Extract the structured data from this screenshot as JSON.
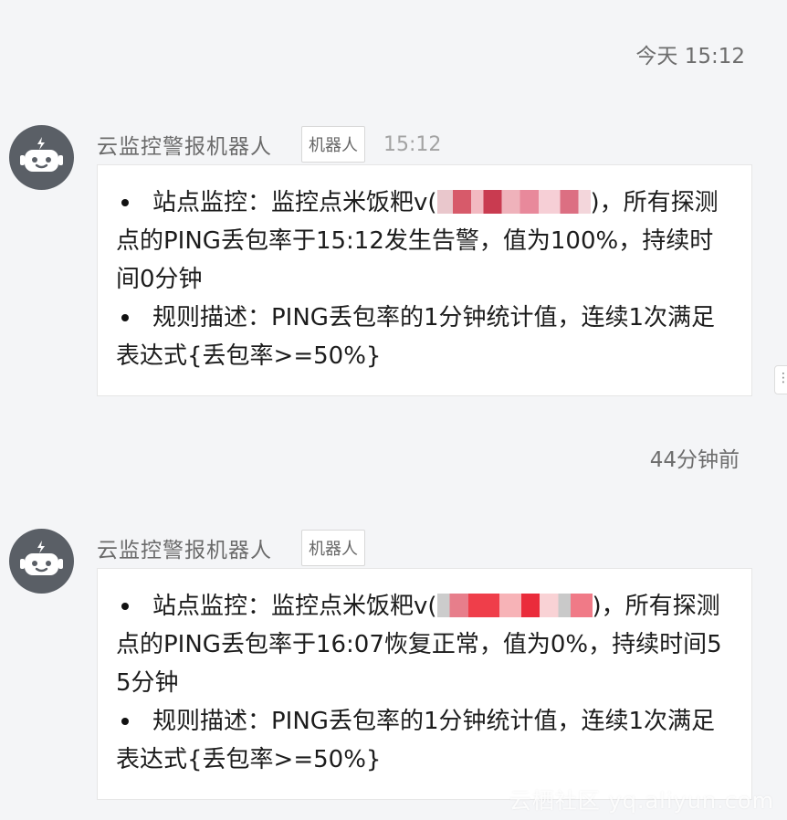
{
  "timestamps": [
    "今天 15:12",
    "44分钟前"
  ],
  "messages": [
    {
      "sender": "云监控警报机器人",
      "badge": "机器人",
      "time": "15:12",
      "items": [
        {
          "prefix": "站点监控：监控点米饭粑v(",
          "suffix": ")，所有探测点的PING丢包率于15:12发生告警，值为100%，持续时间0分钟"
        },
        {
          "text": "规则描述：PING丢包率的1分钟统计值，连续1次满足表达式{丢包率>=50%}"
        }
      ]
    },
    {
      "sender": "云监控警报机器人",
      "badge": "机器人",
      "time": "",
      "items": [
        {
          "prefix": "站点监控：监控点米饭粑v(",
          "suffix": ")，所有探测点的PING丢包率于16:07恢复正常，值为0%，持续时间55分钟"
        },
        {
          "text": "规则描述：PING丢包率的1分钟统计值，连续1次满足表达式{丢包率>=50%}"
        }
      ]
    }
  ],
  "watermark": "云栖社区 yq.aliyun.com",
  "colors": {
    "background": "#f4f5f7",
    "avatar": "#5a5f66",
    "card": "#ffffff"
  }
}
